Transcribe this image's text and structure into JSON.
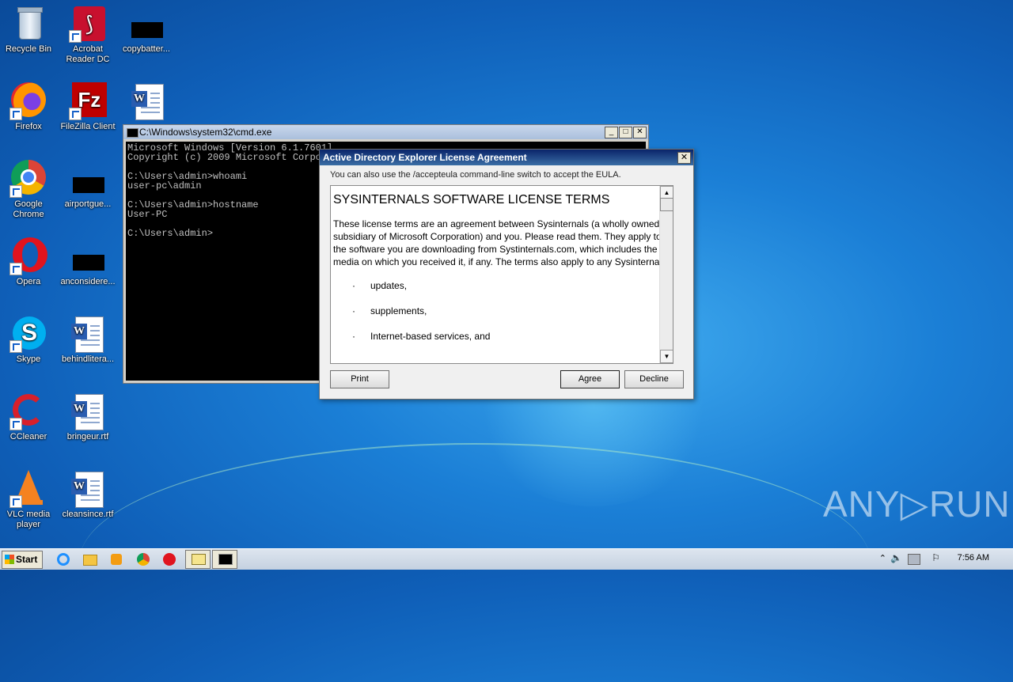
{
  "desktop": {
    "icons": [
      {
        "label": "Recycle Bin"
      },
      {
        "label": "Acrobat\nReader DC"
      },
      {
        "label": "copybatter..."
      },
      {
        "label": "Firefox"
      },
      {
        "label": "FileZilla Client"
      },
      {
        "label": ""
      },
      {
        "label": "Google\nChrome"
      },
      {
        "label": "airportgue..."
      },
      {
        "label": "Opera"
      },
      {
        "label": "anconsidere..."
      },
      {
        "label": "Skype"
      },
      {
        "label": "behindlitera..."
      },
      {
        "label": "CCleaner"
      },
      {
        "label": "bringeur.rtf"
      },
      {
        "label": "VLC media\nplayer"
      },
      {
        "label": "cleansince.rtf"
      }
    ]
  },
  "cmd": {
    "title": "C:\\Windows\\system32\\cmd.exe",
    "lines": "Microsoft Windows [Version 6.1.7601]\nCopyright (c) 2009 Microsoft Corporation.  All rights reserved.\n\nC:\\Users\\admin>whoami\nuser-pc\\admin\n\nC:\\Users\\admin>hostname\nUser-PC\n\nC:\\Users\\admin>"
  },
  "dialog": {
    "title": "Active Directory Explorer License Agreement",
    "hint": "You can also use the /accepteula command-line switch to accept the EULA.",
    "heading": "SYSINTERNALS SOFTWARE LICENSE TERMS",
    "paragraph": "These license terms are an agreement between Sysinternals (a wholly owned subsidiary of Microsoft Corporation) and you.  Please read them. They apply to the software you are downloading from Systinternals.com, which includes the media on which you received it, if any.  The terms also apply to any Sysinternals",
    "bullets": [
      "updates,",
      "supplements,",
      "Internet-based services, and"
    ],
    "print_label": "Print",
    "agree_label": "Agree",
    "decline_label": "Decline"
  },
  "taskbar": {
    "start_label": "Start",
    "clock": "7:56 AM"
  },
  "watermark": "ANY▷RUN"
}
